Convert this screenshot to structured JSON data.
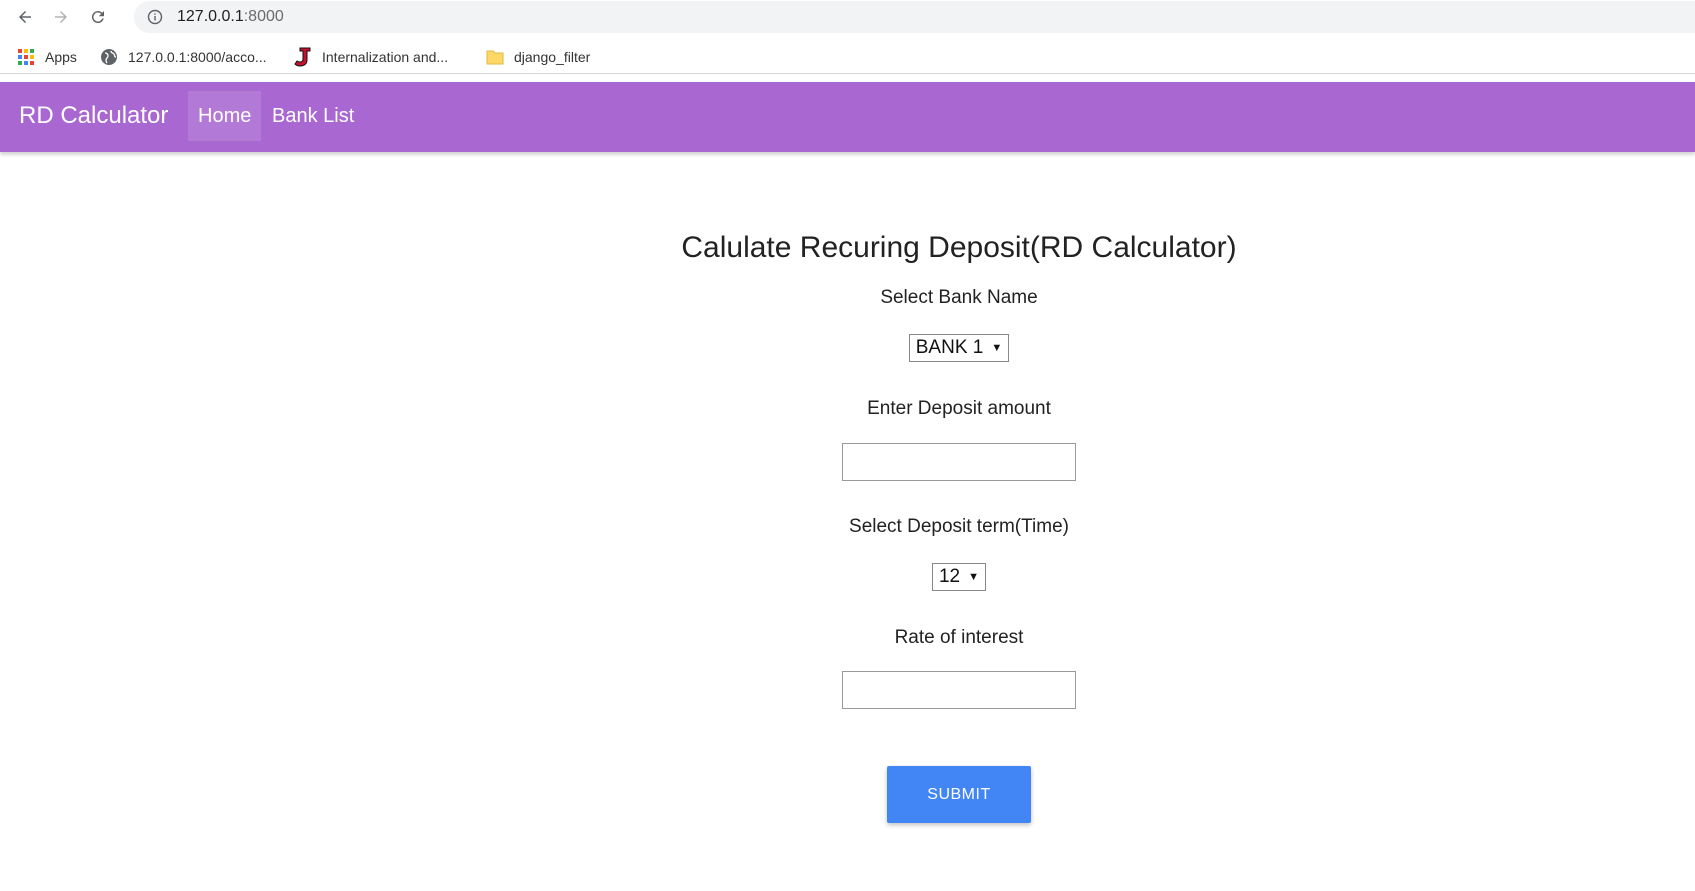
{
  "browser": {
    "url_host": "127.0.0.1",
    "url_port": ":8000",
    "bookmarks": [
      {
        "label": "Apps",
        "icon": "apps-grid-icon"
      },
      {
        "label": "127.0.0.1:8000/acco...",
        "icon": "globe-icon"
      },
      {
        "label": "Internalization and...",
        "icon": "j-logo-icon"
      },
      {
        "label": "django_filter",
        "icon": "folder-icon"
      }
    ]
  },
  "navbar": {
    "brand": "RD Calculator",
    "items": [
      {
        "label": "Home",
        "active": true
      },
      {
        "label": "Bank List",
        "active": false
      }
    ],
    "color": "#a967d2"
  },
  "form": {
    "title": "Calulate Recuring Deposit(RD Calculator)",
    "bank_label": "Select Bank Name",
    "bank_selected": "BANK 1",
    "amount_label": "Enter Deposit amount",
    "amount_value": "",
    "term_label": "Select Deposit term(Time)",
    "term_selected": "12",
    "rate_label": "Rate of interest",
    "rate_value": "",
    "submit_label": "SUBMIT",
    "submit_color": "#4285f4"
  }
}
